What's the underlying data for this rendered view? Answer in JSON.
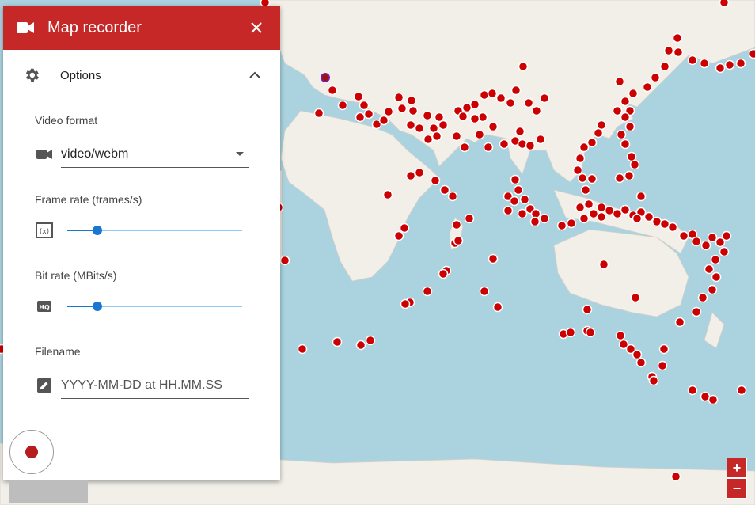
{
  "panel": {
    "title": "Map recorder",
    "options_label": "Options",
    "video_format": {
      "label": "Video format",
      "value": "video/webm"
    },
    "frame_rate": {
      "label": "Frame rate (frames/s)",
      "level": 0.17
    },
    "bit_rate": {
      "label": "Bit rate (MBits/s)",
      "level": 0.17
    },
    "filename": {
      "label": "Filename",
      "placeholder": "YYYY-MM-DD at HH.MM.SS"
    }
  },
  "zoom": {
    "in_label": "+",
    "out_label": "−"
  },
  "colors": {
    "accent": "#c62828",
    "marker": "#cc0000",
    "slider": "#1976d2"
  }
}
